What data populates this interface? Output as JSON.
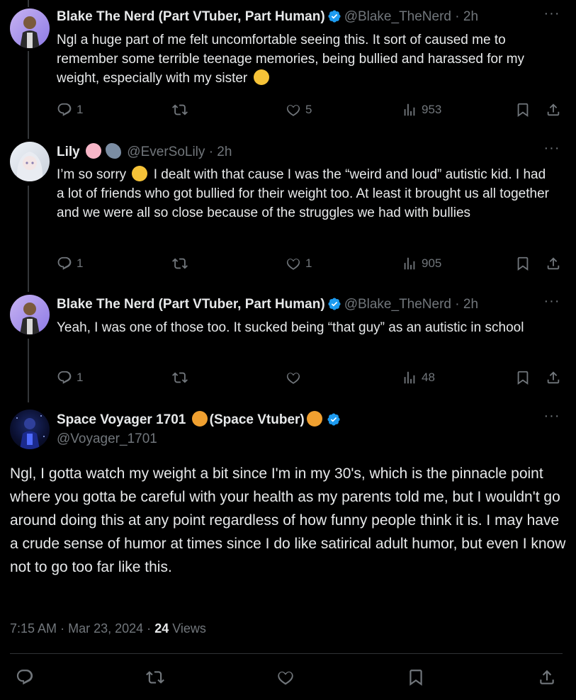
{
  "replies": [
    {
      "name": "Blake The Nerd (Part VTuber, Part Human)",
      "handle": "@Blake_TheNerd",
      "sep": "·",
      "time": "2h",
      "text": "Ngl a huge part of me felt uncomfortable seeing this. It sort of caused me to remember some terrible teenage memories, being bullied and harassed for my weight, especially with my sister",
      "emoji": "face-with-hand-over-mouth",
      "replies": "1",
      "likes": "5",
      "views": "953"
    },
    {
      "name": "Lily",
      "handle": "@EverSoLily",
      "sep": "·",
      "time": "2h",
      "text_before": "I’m so sorry",
      "text_after": "I dealt with that cause I was the “weird and loud” autistic kid. I had a lot of friends who got bullied for their weight too. At least it brought us all together and we were all so close because of the struggles we had with bullies",
      "name_emojis": [
        "cherry-blossom",
        "shark"
      ],
      "replies": "1",
      "likes": "1",
      "views": "905"
    },
    {
      "name": "Blake The Nerd (Part VTuber, Part Human)",
      "handle": "@Blake_TheNerd",
      "sep": "·",
      "time": "2h",
      "text": "Yeah, I was one of those too. It sucked being “that guy” as an autistic in school",
      "replies": "1",
      "likes": "",
      "views": "48"
    }
  ],
  "focus": {
    "name_part1": "Space Voyager 1701",
    "name_part2": "(Space Vtuber)",
    "name_emoji": "ringed-planet",
    "handle": "@Voyager_1701",
    "text": "Ngl, I gotta watch my weight a bit since I'm in my 30's, which is the pinnacle point where you gotta be careful with your health as my parents told me, but I wouldn't go around doing this at any point regardless of how funny people think it is. I may have a crude sense of humor at times since I do like satirical adult humor, but even I know not to go too far like this.",
    "time": "7:15 AM",
    "sep": "·",
    "date": "Mar 23, 2024",
    "views_count": "24",
    "views_label": "Views"
  },
  "more_label": "···",
  "colors": {
    "verified": "#1d9bf0",
    "muted": "#71767b",
    "background": "#000000"
  }
}
